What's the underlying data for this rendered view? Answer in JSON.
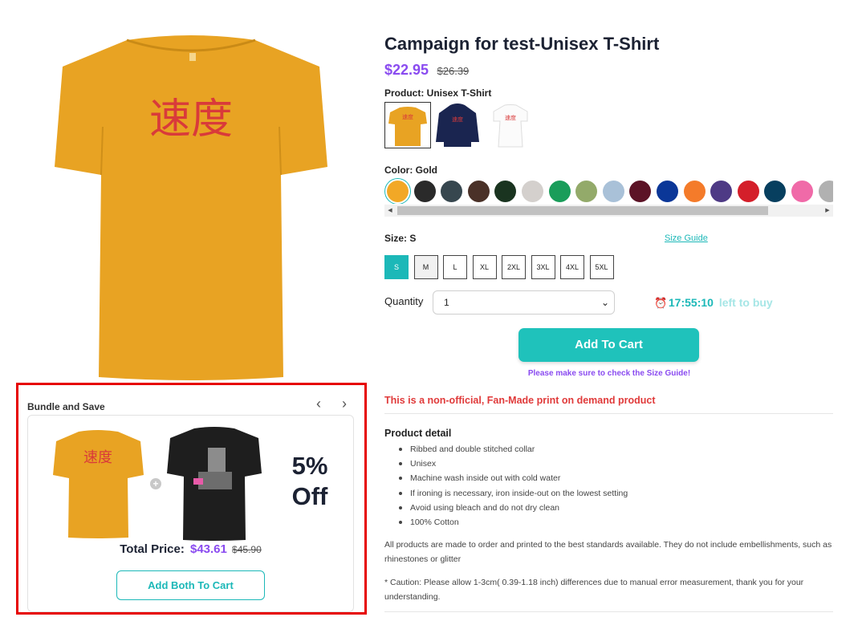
{
  "product": {
    "title": "Campaign for test-Unisex T-Shirt",
    "price": "$22.95",
    "original_price": "$26.39",
    "design_text": "速度",
    "product_label": "Product: Unisex T-Shirt",
    "product_types": [
      {
        "name": "unisex-tshirt",
        "color": "#e8a323"
      },
      {
        "name": "hoodie",
        "color": "#1a2550"
      },
      {
        "name": "ladies-tee",
        "color": "#ffffff"
      }
    ],
    "color_label": "Color: Gold",
    "colors": [
      "#f2a826",
      "#2a2a2a",
      "#37474f",
      "#4a3128",
      "#1a3420",
      "#d4d0cd",
      "#1a9d5a",
      "#93aa6a",
      "#a9c1d8",
      "#5c1326",
      "#0b3798",
      "#f47b2a",
      "#4e3a85",
      "#d41f2a",
      "#073f5f",
      "#f06aa8",
      "#b1b1b1"
    ],
    "selected_color": "Gold",
    "size_label": "Size: S",
    "size_guide": "Size Guide",
    "sizes": [
      "S",
      "M",
      "L",
      "XL",
      "2XL",
      "3XL",
      "4XL",
      "5XL"
    ],
    "selected_size": "S",
    "quantity_label": "Quantity",
    "quantity_value": "1",
    "timer": "17:55:10",
    "timer_suffix": "left to buy",
    "add_to_cart": "Add To Cart",
    "size_note": "Please make sure to check the Size Guide!",
    "disclaimer": "This is a non-official, Fan-Made print on demand product",
    "detail_title": "Product detail",
    "details": [
      "Ribbed and double stitched collar",
      "Unisex",
      "Machine wash inside out with cold water",
      "If ironing is necessary, iron inside-out on the lowest setting",
      "Avoid using bleach and do not dry clean",
      "100% Cotton"
    ],
    "standards_text": "All products are made to order and printed to the best standards available. They do not include embellishments, such as rhinestones or glitter",
    "caution_text": "* Caution: Please allow 1-3cm( 0.39-1.18 inch) differences due to manual error measurement, thank you for your understanding."
  },
  "bundle": {
    "title": "Bundle and Save",
    "prev_icon": "chevron-left-icon",
    "next_icon": "chevron-right-icon",
    "discount_line1": "5%",
    "discount_line2": "Off",
    "total_label": "Total Price:",
    "total_price": "$43.61",
    "total_original": "$45.90",
    "button_label": "Add Both To Cart",
    "shirt1_color": "#e8a323",
    "shirt2_color": "#1e1e1e"
  },
  "colors": {
    "accent": "#1cb8b8",
    "price": "#8a4bf0",
    "warning": "#e03a3a",
    "highlight_border": "#e60000"
  }
}
